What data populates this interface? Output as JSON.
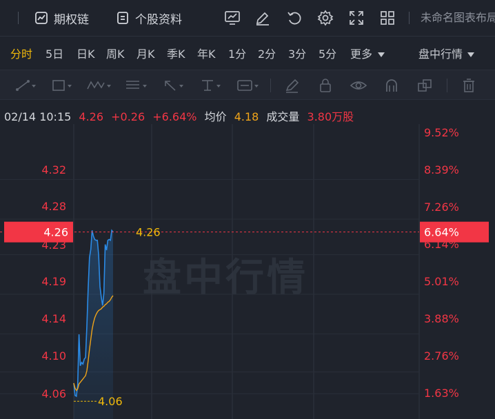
{
  "toolbar": {
    "options_chain_label": "期权链",
    "profile_label": "个股资料",
    "untitled_layout": "未命名图表布局"
  },
  "periods": [
    "分时",
    "5日",
    "日K",
    "周K",
    "月K",
    "季K",
    "年K",
    "1分",
    "2分",
    "3分",
    "5分"
  ],
  "more_label": "更多",
  "session_label": "盘中行情",
  "info": {
    "datetime": "02/14 10:15",
    "price": "4.26",
    "change": "+0.26",
    "change_pct": "+6.64%",
    "avg_label": "均价",
    "avg_value": "4.18",
    "volume_label": "成交量",
    "volume_value": "3.80万股"
  },
  "watermark": "盘中行情",
  "colors": {
    "up_red": "#f23645",
    "avg_orange": "#f0a419",
    "price_blue": "#2b8be6",
    "active_yellow": "#f0b90b"
  },
  "chart_data": {
    "type": "line",
    "price_ticks": [
      "4.32",
      "4.28",
      "4.23",
      "4.19",
      "4.14",
      "4.10",
      "4.06"
    ],
    "pct_ticks": [
      "9.52%",
      "8.39%",
      "7.26%",
      "6.14%",
      "5.01%",
      "3.88%",
      "2.76%",
      "1.63%"
    ],
    "ylim": [
      4.0381,
      4.3808
    ],
    "current_price": 4.26,
    "current_price_label": "4.26",
    "current_pct_label": "6.64%",
    "low_label": "4.06",
    "low_value": 4.06,
    "series": [
      {
        "values": [
          4.077,
          4.062,
          4.061,
          4.075,
          4.136,
          4.098,
          4.102,
          4.1,
          4.106,
          4.108,
          4.146,
          4.192,
          4.229,
          4.239,
          4.262,
          4.255,
          4.251,
          4.25,
          4.25,
          4.232,
          4.194,
          4.181,
          4.171,
          4.186,
          4.245,
          4.238,
          4.25,
          4.251,
          4.25,
          4.262,
          4.26
        ]
      },
      {
        "values": [
          4.077,
          4.071,
          4.068,
          4.07,
          4.076,
          4.078,
          4.08,
          4.082,
          4.084,
          4.086,
          4.092,
          4.104,
          4.118,
          4.13,
          4.142,
          4.15,
          4.156,
          4.16,
          4.163,
          4.165,
          4.166,
          4.167,
          4.169,
          4.17,
          4.172,
          4.173,
          4.175,
          4.176,
          4.178,
          4.181,
          4.183
        ]
      }
    ]
  }
}
